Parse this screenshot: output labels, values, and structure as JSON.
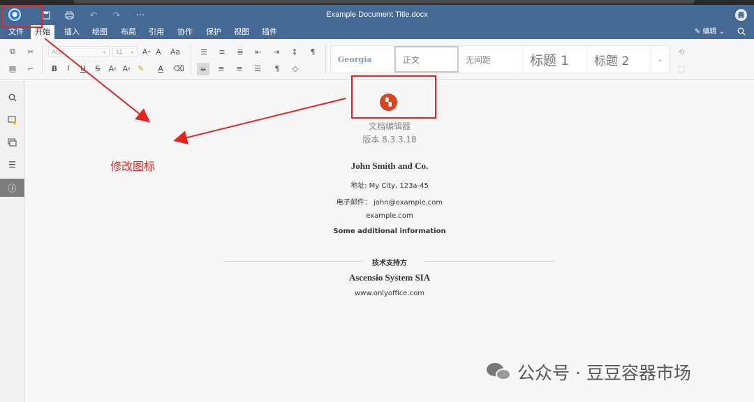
{
  "window": {
    "title": "Example Document Title.docx",
    "avatar_initial": "爨"
  },
  "menu": {
    "items": [
      "文件",
      "开始",
      "插入",
      "绘图",
      "布局",
      "引用",
      "协作",
      "保护",
      "视图",
      "插件"
    ],
    "active": "开始",
    "edit_mode": "编辑"
  },
  "toolbar": {
    "font_name": "Arial",
    "font_size": "11",
    "styles": [
      "Georgia",
      "正文",
      "无间距",
      "标题 1",
      "标题 2"
    ],
    "selected_style": "正文"
  },
  "about": {
    "app_name": "文档编辑器",
    "version": "版本 8.3.3.18",
    "company": "John Smith and Co.",
    "address": "地址: My City, 123a-45",
    "email_label": "电子邮件：",
    "email": "john@example.com",
    "site": "example.com",
    "additional": "Some additional information",
    "support_label": "技术支持方",
    "vendor": "Ascensio System SIA",
    "vendor_site": "www.onlyoffice.com"
  },
  "annotation": {
    "text": "修改图标",
    "color": "#e8231e"
  },
  "watermark": {
    "text": "公众号 · 豆豆容器市场"
  },
  "colors": {
    "header": "#446995",
    "accent_red": "#e8231e",
    "app_icon": "#d9441d"
  }
}
